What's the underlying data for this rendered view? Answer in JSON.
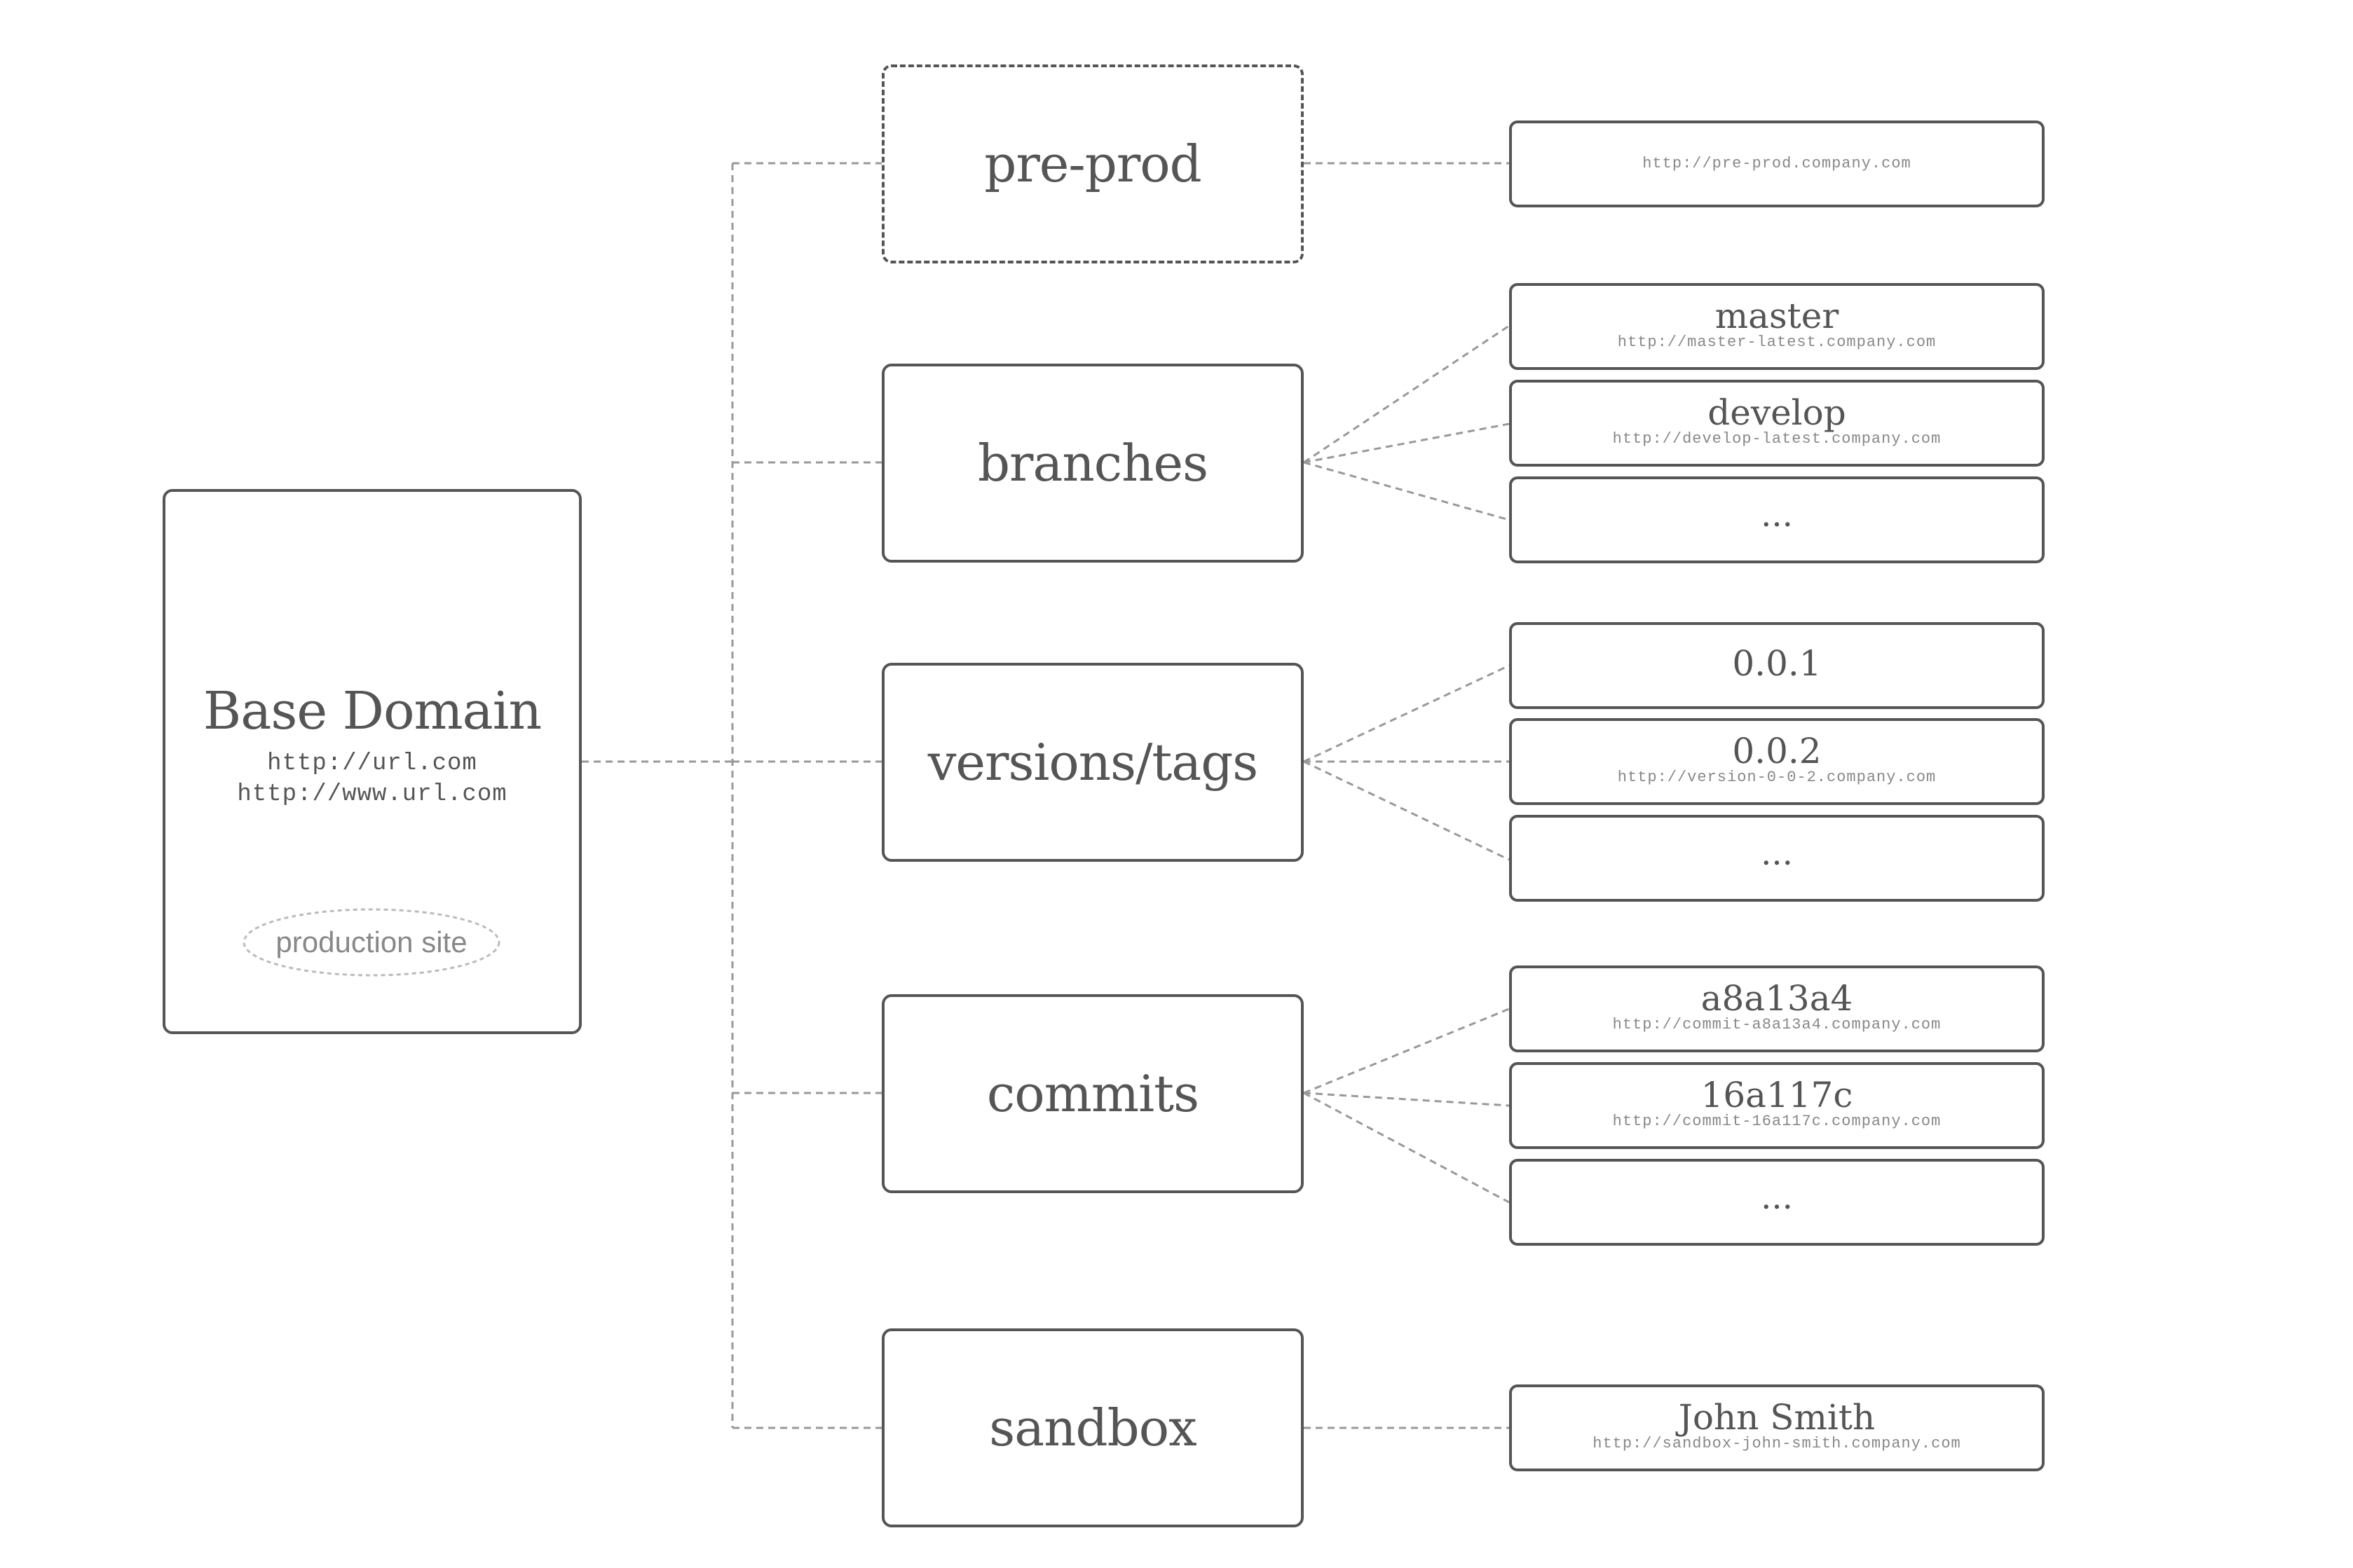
{
  "base": {
    "title": "Base Domain",
    "url1": "http://url.com",
    "url2": "http://www.url.com",
    "badge": "production site"
  },
  "categories": {
    "preprod": "pre-prod",
    "branches": "branches",
    "versions": "versions/tags",
    "commits": "commits",
    "sandbox": "sandbox"
  },
  "targets": {
    "preprod": {
      "url": "http://pre-prod.company.com"
    },
    "master": {
      "name": "master",
      "url": "http://master-latest.company.com"
    },
    "develop": {
      "name": "develop",
      "url": "http://develop-latest.company.com"
    },
    "branches_more": {
      "name": "..."
    },
    "v001": {
      "name": "0.0.1"
    },
    "v002": {
      "name": "0.0.2",
      "url": "http://version-0-0-2.company.com"
    },
    "versions_more": {
      "name": "..."
    },
    "c1": {
      "name": "a8a13a4",
      "url": "http://commit-a8a13a4.company.com"
    },
    "c2": {
      "name": "16a117c",
      "url": "http://commit-16a117c.company.com"
    },
    "commits_more": {
      "name": "..."
    },
    "sandbox_user": {
      "name": "John Smith",
      "url": "http://sandbox-john-smith.company.com"
    }
  },
  "colors": {
    "box_border": "#555555",
    "connector": "#999999",
    "text": "#555555",
    "muted_text": "#888888"
  }
}
